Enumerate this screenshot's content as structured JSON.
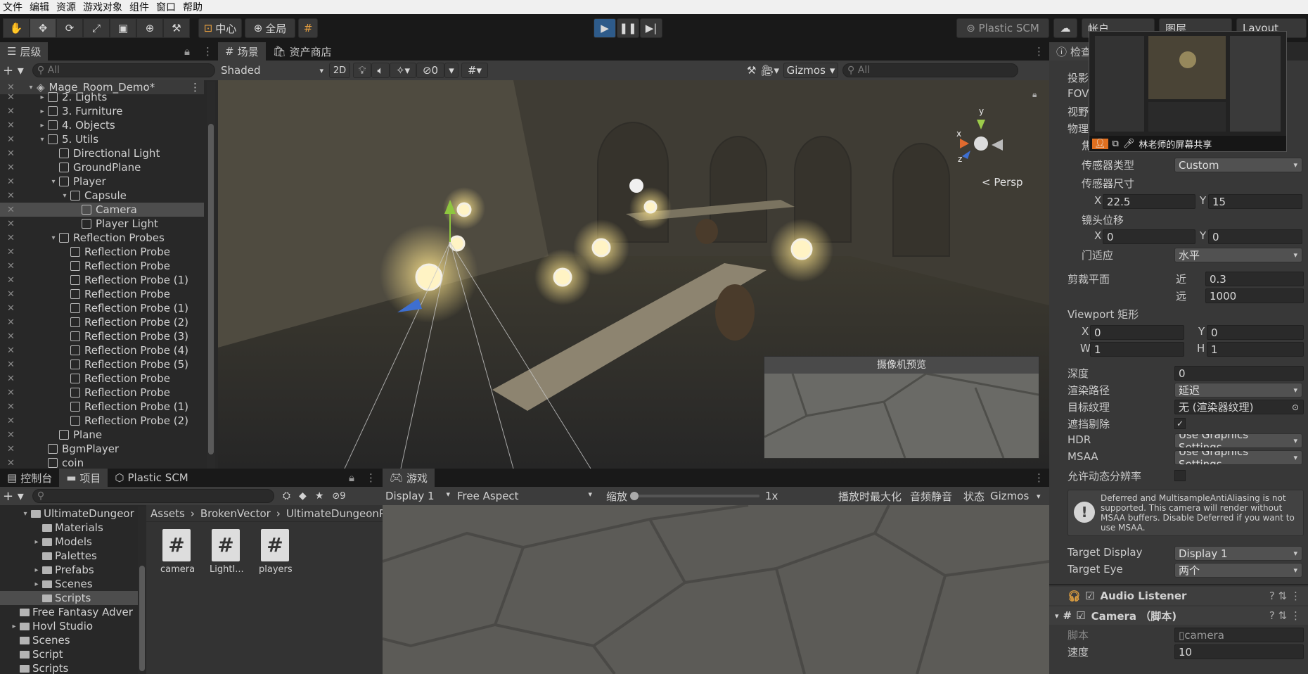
{
  "menu": [
    "文件",
    "编辑",
    "资源",
    "游戏对象",
    "组件",
    "窗口",
    "帮助"
  ],
  "toolbar": {
    "pivot": "中心",
    "space": "全局",
    "plastic": "Plastic SCM",
    "account": "帐户",
    "layers": "图层",
    "layout": "Layout"
  },
  "hierarchy": {
    "tab": "层级",
    "search_placeholder": "All",
    "scene": "Mage_Room_Demo*",
    "items": [
      {
        "label": "2. Lights",
        "indent": 1,
        "arrow": "▸",
        "selected": false
      },
      {
        "label": "3. Furniture",
        "indent": 1,
        "arrow": "▸",
        "selected": false
      },
      {
        "label": "4. Objects",
        "indent": 1,
        "arrow": "▸",
        "selected": false
      },
      {
        "label": "5. Utils",
        "indent": 1,
        "arrow": "▾",
        "selected": false
      },
      {
        "label": "Directional Light",
        "indent": 2,
        "arrow": "",
        "selected": false
      },
      {
        "label": "GroundPlane",
        "indent": 2,
        "arrow": "",
        "selected": false
      },
      {
        "label": "Player",
        "indent": 2,
        "arrow": "▾",
        "selected": false
      },
      {
        "label": "Capsule",
        "indent": 3,
        "arrow": "▾",
        "selected": false
      },
      {
        "label": "Camera",
        "indent": 4,
        "arrow": "",
        "selected": true
      },
      {
        "label": "Player Light",
        "indent": 4,
        "arrow": "",
        "selected": false
      },
      {
        "label": "Reflection Probes",
        "indent": 2,
        "arrow": "▾",
        "selected": false
      },
      {
        "label": "Reflection Probe",
        "indent": 3,
        "arrow": "",
        "selected": false
      },
      {
        "label": "Reflection Probe",
        "indent": 3,
        "arrow": "",
        "selected": false
      },
      {
        "label": "Reflection Probe (1)",
        "indent": 3,
        "arrow": "",
        "selected": false
      },
      {
        "label": "Reflection Probe",
        "indent": 3,
        "arrow": "",
        "selected": false
      },
      {
        "label": "Reflection Probe (1)",
        "indent": 3,
        "arrow": "",
        "selected": false
      },
      {
        "label": "Reflection Probe (2)",
        "indent": 3,
        "arrow": "",
        "selected": false
      },
      {
        "label": "Reflection Probe (3)",
        "indent": 3,
        "arrow": "",
        "selected": false
      },
      {
        "label": "Reflection Probe (4)",
        "indent": 3,
        "arrow": "",
        "selected": false
      },
      {
        "label": "Reflection Probe (5)",
        "indent": 3,
        "arrow": "",
        "selected": false
      },
      {
        "label": "Reflection Probe",
        "indent": 3,
        "arrow": "",
        "selected": false
      },
      {
        "label": "Reflection Probe",
        "indent": 3,
        "arrow": "",
        "selected": false
      },
      {
        "label": "Reflection Probe (1)",
        "indent": 3,
        "arrow": "",
        "selected": false
      },
      {
        "label": "Reflection Probe (2)",
        "indent": 3,
        "arrow": "",
        "selected": false
      },
      {
        "label": "Plane",
        "indent": 2,
        "arrow": "",
        "selected": false
      },
      {
        "label": "BgmPlayer",
        "indent": 1,
        "arrow": "",
        "selected": false
      },
      {
        "label": "coin",
        "indent": 1,
        "arrow": "",
        "selected": false
      }
    ]
  },
  "scene_view": {
    "tab_scene": "场景",
    "tab_store": "资产商店",
    "shading": "Shaded",
    "mode2d": "2D",
    "hidden_count": "0",
    "gizmos": "Gizmos",
    "search_placeholder": "All",
    "persp": "< Persp",
    "axis_y": "y",
    "axis_x": "x",
    "axis_z": "z",
    "camera_preview": "摄像机预览"
  },
  "bottom_left": {
    "tab_console": "控制台",
    "tab_project": "项目",
    "tab_plastic": "Plastic SCM",
    "hidden_count": "9",
    "tree": [
      {
        "label": "UltimateDungeor",
        "indent": 1,
        "arrow": "▾",
        "selected": false
      },
      {
        "label": "Materials",
        "indent": 2,
        "arrow": "",
        "selected": false
      },
      {
        "label": "Models",
        "indent": 2,
        "arrow": "▸",
        "selected": false
      },
      {
        "label": "Palettes",
        "indent": 2,
        "arrow": "",
        "selected": false
      },
      {
        "label": "Prefabs",
        "indent": 2,
        "arrow": "▸",
        "selected": false
      },
      {
        "label": "Scenes",
        "indent": 2,
        "arrow": "▸",
        "selected": false
      },
      {
        "label": "Scripts",
        "indent": 2,
        "arrow": "",
        "selected": true
      },
      {
        "label": "Free Fantasy Adver",
        "indent": 0,
        "arrow": "",
        "selected": false
      },
      {
        "label": "Hovl Studio",
        "indent": 0,
        "arrow": "▸",
        "selected": false
      },
      {
        "label": "Scenes",
        "indent": 0,
        "arrow": "",
        "selected": false
      },
      {
        "label": "Script",
        "indent": 0,
        "arrow": "",
        "selected": false
      },
      {
        "label": "Scripts",
        "indent": 0,
        "arrow": "",
        "selected": false
      }
    ],
    "breadcrumb": [
      "Assets",
      "BrokenVector",
      "UltimateDungeonP"
    ],
    "files": [
      "camera",
      "LightI...",
      "players"
    ]
  },
  "game_view": {
    "tab": "游戏",
    "display": "Display 1",
    "aspect": "Free Aspect",
    "scale_label": "缩放",
    "scale_value": "1x",
    "maximize": "播放时最大化",
    "mute": "音频静音",
    "stats": "状态",
    "gizmos": "Gizmos"
  },
  "inspector": {
    "tab": "检查",
    "projection_label": "投影",
    "fov_label": "FOV",
    "view_label": "视野",
    "physical_label": "物理",
    "focal_label": "焦距",
    "sensor_type_label": "传感器类型",
    "sensor_type": "Custom",
    "sensor_size_label": "传感器尺寸",
    "sensor_x": "22.5",
    "sensor_y": "15",
    "lens_shift_label": "镜头位移",
    "shift_x": "0",
    "shift_y": "0",
    "gate_fit_label": "门适应",
    "gate_fit": "水平",
    "clip_label": "剪裁平面",
    "near_label": "近",
    "near": "0.3",
    "far_label": "远",
    "far": "1000",
    "viewport_label": "Viewport 矩形",
    "vx": "0",
    "vy": "0",
    "vw": "1",
    "vh": "1",
    "depth_label": "深度",
    "depth": "0",
    "render_path_label": "渲染路径",
    "render_path": "延迟",
    "target_tex_label": "目标纹理",
    "target_tex": "无 (渲染器纹理)",
    "occlusion_label": "遮挡剔除",
    "hdr_label": "HDR",
    "hdr": "Use Graphics Settings",
    "msaa_label": "MSAA",
    "msaa": "Use Graphics Settings",
    "dynres_label": "允许动态分辨率",
    "warning": "Deferred and MultisampleAntiAliasing is not supported. This camera will render without MSAA buffers. Disable Deferred if you want to use MSAA.",
    "target_display_label": "Target Display",
    "target_display": "Display 1",
    "target_eye_label": "Target Eye",
    "target_eye": "两个",
    "audio_listener": "Audio Listener",
    "camera_script": "Camera （脚本)",
    "script_label": "脚本",
    "script_value": "camera",
    "speed_label": "速度",
    "speed": "10",
    "share_label": "林老师的屏幕共享",
    "letter_x": "X",
    "letter_y": "Y",
    "letter_w": "W",
    "letter_h": "H"
  },
  "colors": {
    "accent": "#3a72b0",
    "selection": "#4d4d4d",
    "play_active": "#2e5b8a"
  }
}
